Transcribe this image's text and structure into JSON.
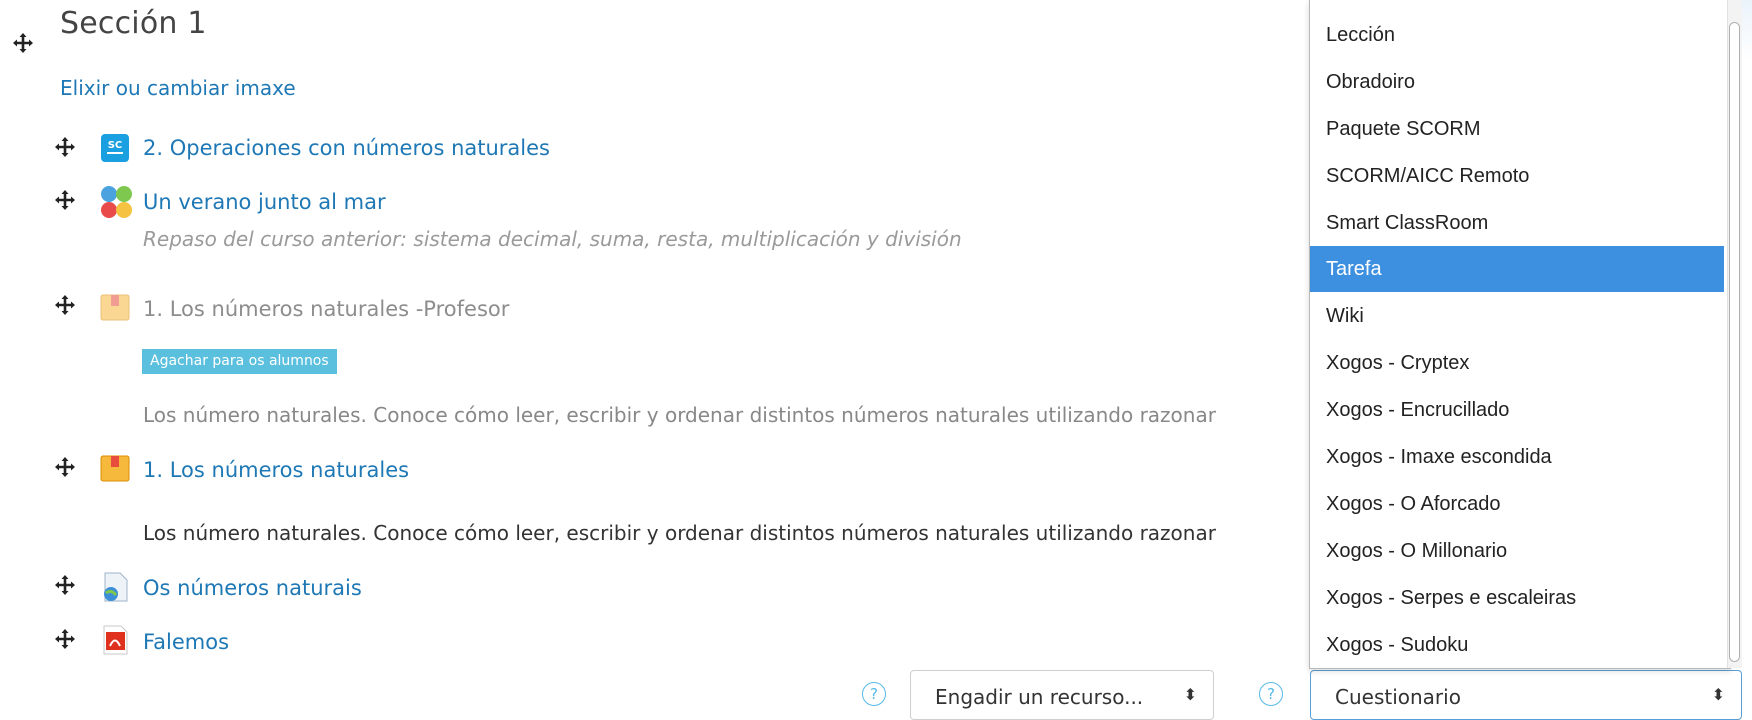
{
  "section": {
    "title": "Sección 1",
    "change_image_link": "Elixir ou cambiar imaxe"
  },
  "activities": [
    {
      "icon": "scorm-icon",
      "title": "2. Operaciones con números naturales"
    },
    {
      "icon": "game-puzzle-icon",
      "title": "Un verano junto al mar",
      "description": "Repaso del curso anterior: sistema decimal, suma, resta, multiplicación y división"
    },
    {
      "icon": "package-icon",
      "title": "1. Los números naturales -Profesor",
      "badge": "Agachar para os alumnos",
      "description": "Los número naturales. Conoce cómo leer, escribir y ordenar distintos números naturales utilizando razonar"
    },
    {
      "icon": "package-icon",
      "title": "1. Los números naturales",
      "description": "Los número naturales. Conoce cómo leer, escribir y ordenar distintos números naturales utilizando razonar"
    },
    {
      "icon": "file-globe-icon",
      "title": "Os números naturais"
    },
    {
      "icon": "pdf-icon",
      "title": "Falemos"
    }
  ],
  "add_resource_select": {
    "value": "Engadir un recurso...",
    "arrows": "⬍"
  },
  "add_activity_select": {
    "value": "Cuestionario",
    "arrows": "⬍"
  },
  "help_icon_text": "?",
  "dropdown": {
    "items": [
      "Lección",
      "Obradoiro",
      "Paquete SCORM",
      "SCORM/AICC Remoto",
      "Smart ClassRoom",
      "Tarefa",
      "Wiki",
      "Xogos - Cryptex",
      "Xogos - Encrucillado",
      "Xogos - Imaxe escondida",
      "Xogos - O Aforcado",
      "Xogos - O Millonario",
      "Xogos - Serpes e escaleiras",
      "Xogos - Sudoku"
    ],
    "selected": "Tarefa"
  },
  "colors": {
    "link": "#1e78b5",
    "badge": "#5bc0de",
    "selected": "#3d8fe0"
  }
}
